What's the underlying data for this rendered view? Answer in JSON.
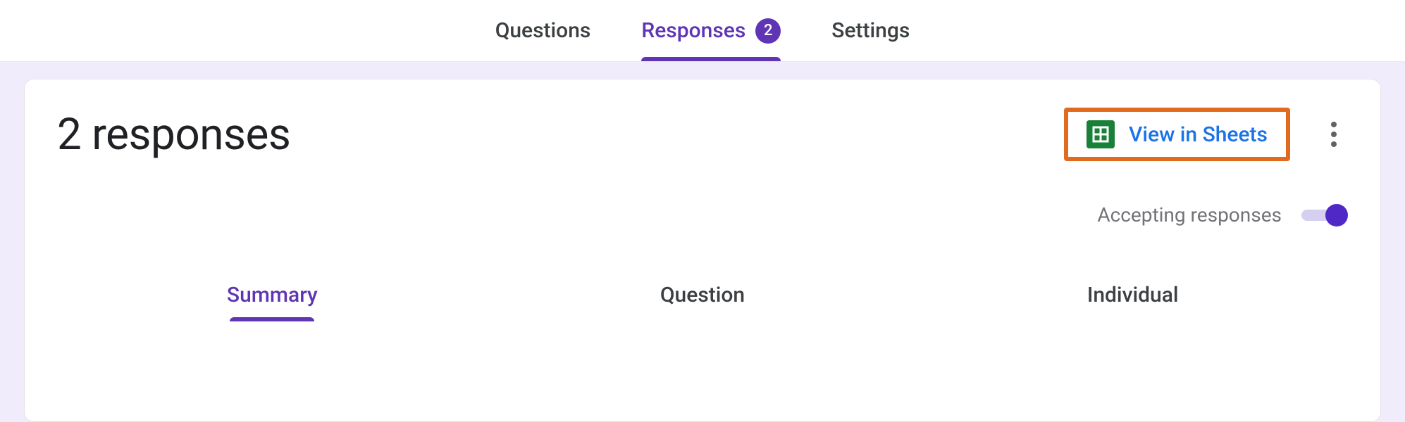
{
  "top_tabs": {
    "questions": "Questions",
    "responses": "Responses",
    "responses_count": "2",
    "settings": "Settings"
  },
  "card": {
    "title": "2 responses",
    "view_in_sheets": "View in Sheets",
    "accepting_label": "Accepting responses"
  },
  "sub_tabs": {
    "summary": "Summary",
    "question": "Question",
    "individual": "Individual"
  }
}
